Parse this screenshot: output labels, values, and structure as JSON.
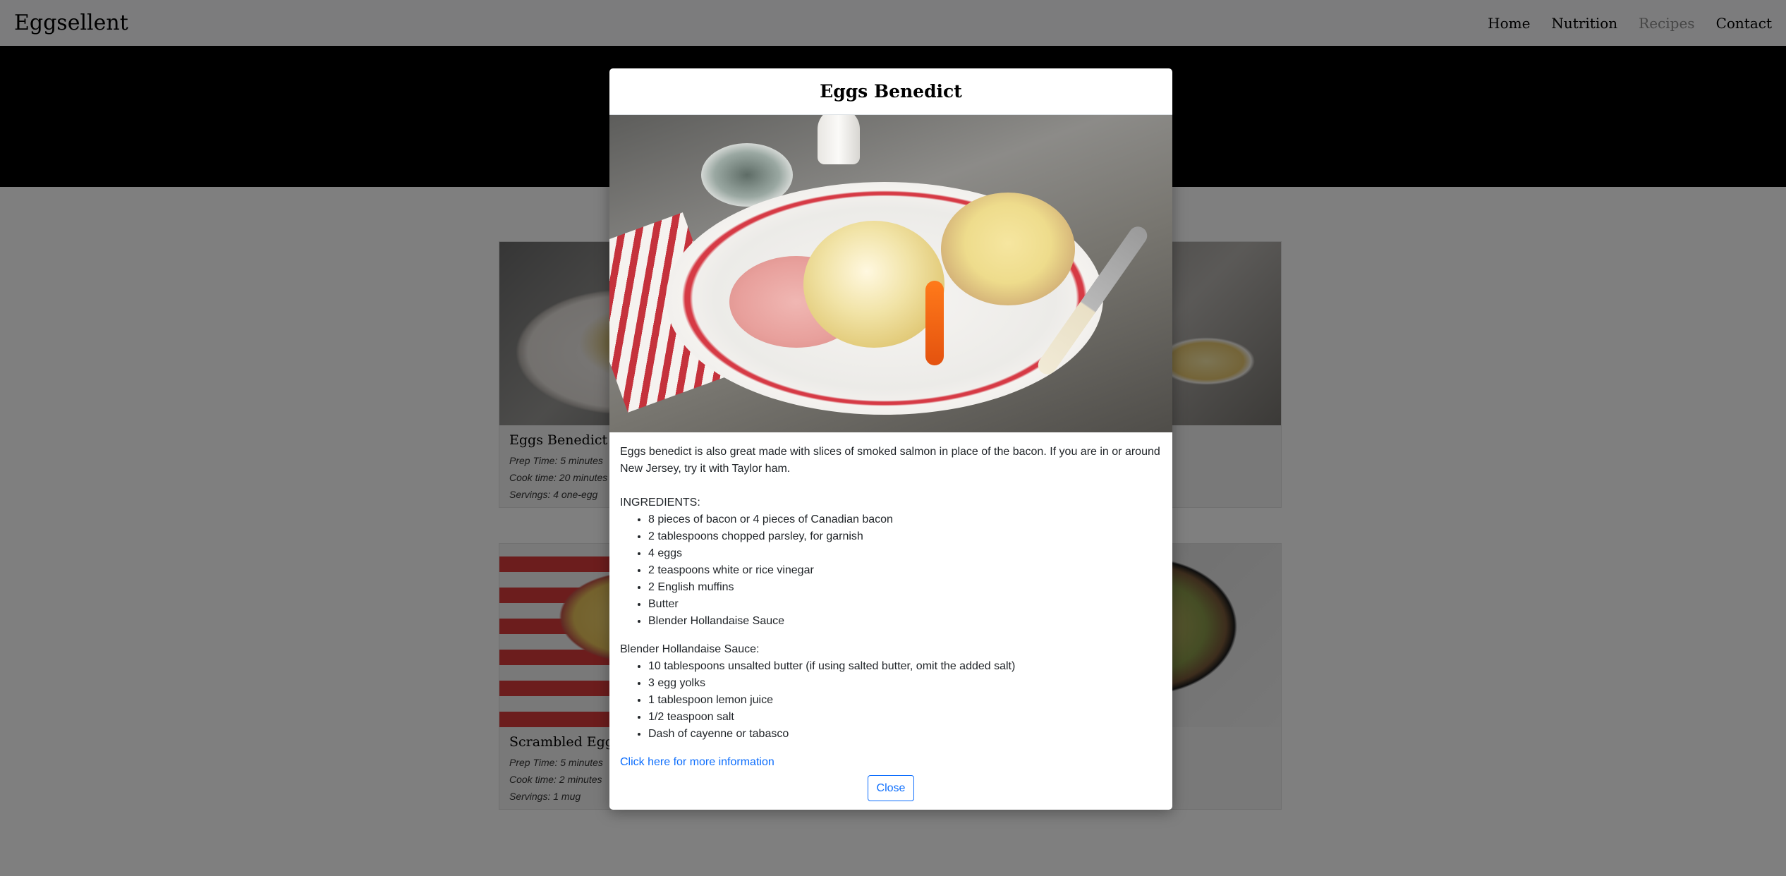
{
  "navbar": {
    "brand": "Eggsellent",
    "links": [
      {
        "label": "Home"
      },
      {
        "label": "Nutrition"
      },
      {
        "label": "Recipes"
      },
      {
        "label": "Contact"
      }
    ]
  },
  "cards": [
    {
      "title": "Eggs Benedict",
      "prep": "Prep Time: 5 minutes",
      "cook": "Cook time: 20 minutes",
      "servings": "Servings: 4 one-egg"
    },
    {
      "title": "Scrambled Eggs i",
      "prep": "Prep Time: 5 minutes",
      "cook": "Cook time: 2 minutes",
      "servings": "Servings: 1 mug"
    }
  ],
  "modal": {
    "title": "Eggs Benedict",
    "description": "Eggs benedict is also great made with slices of smoked salmon in place of the bacon. If you are in or around New Jersey, try it with Taylor ham.",
    "ingredients_label": "INGREDIENTS:",
    "ingredients": [
      "8 pieces of bacon or 4 pieces of Canadian bacon",
      "2 tablespoons chopped parsley, for garnish",
      "4 eggs",
      "2 teaspoons white or rice vinegar",
      "2 English muffins",
      "Butter",
      "Blender Hollandaise Sauce"
    ],
    "sauce_label": "Blender Hollandaise Sauce:",
    "sauce_ingredients": [
      "10 tablespoons unsalted butter (if using salted butter, omit the added salt)",
      "3 egg yolks",
      "1 tablespoon lemon juice",
      "1/2 teaspoon salt",
      "Dash of cayenne or tabasco"
    ],
    "more_link": "Click here for more information",
    "close_label": "Close"
  },
  "colors": {
    "link": "#0d6efd",
    "muted_nav": "#8c8c8c",
    "backdrop": "rgba(0,0,0,0.5)"
  }
}
